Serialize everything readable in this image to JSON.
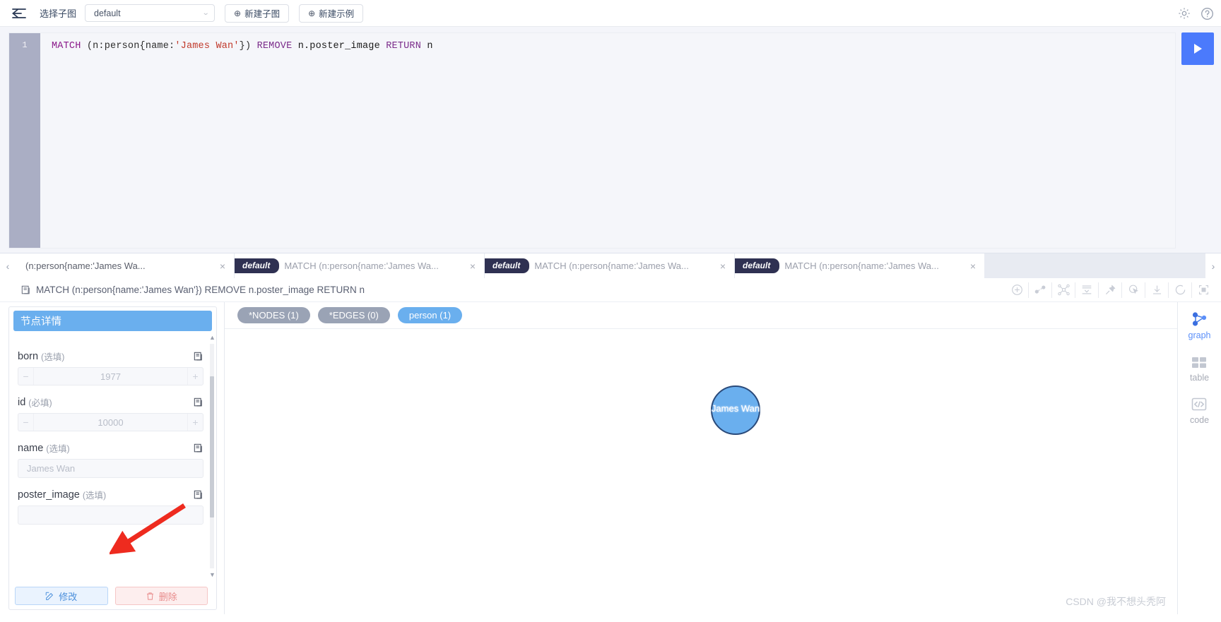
{
  "topbar": {
    "back_icon": "back-arrow-icon",
    "select_label": "选择子图",
    "selected_subgraph": "default",
    "new_subgraph_label": "新建子图",
    "new_sample_label": "新建示例",
    "settings_icon": "gear-icon",
    "help_icon": "question-circle-icon"
  },
  "editor": {
    "line_number": "1",
    "tokens": {
      "match": "MATCH",
      "pattern_open": " (n:person{name:",
      "string": "'James Wan'",
      "pattern_close": "}) ",
      "remove": "REMOVE",
      "prop": " n.poster_image ",
      "return": "RETURN",
      "var": " n"
    },
    "full_query": "MATCH (n:person{name:'James Wan'}) REMOVE n.poster_image RETURN n",
    "run_icon": "play-icon"
  },
  "tabs": {
    "prev_icon": "chevron-left-icon",
    "next_icon": "chevron-right-icon",
    "items": [
      {
        "badge": "",
        "title": "(n:person{name:'James Wa...",
        "close": "×"
      },
      {
        "badge": "default",
        "title": "MATCH (n:person{name:'James Wa...",
        "close": "×"
      },
      {
        "badge": "default",
        "title": "MATCH (n:person{name:'James Wa...",
        "close": "×"
      },
      {
        "badge": "default",
        "title": "MATCH (n:person{name:'James Wa...",
        "close": "×"
      }
    ]
  },
  "result_header": {
    "copy_icon": "copy-icon",
    "query": "MATCH (n:person{name:'James Wan'}) REMOVE n.poster_image RETURN n",
    "tools": [
      "add-circle-icon",
      "expand-nodes-icon",
      "network-icon",
      "collapse-icon",
      "pin-icon",
      "select-cursor-icon",
      "download-icon",
      "refresh-circle-icon",
      "fullscreen-icon"
    ]
  },
  "detail_panel": {
    "title": "节点详情",
    "fields": [
      {
        "name": "born",
        "required_label": "(选填)",
        "type": "number",
        "value": "1977",
        "copy_icon": "copy-icon"
      },
      {
        "name": "id",
        "required_label": "(必填)",
        "type": "number",
        "value": "10000",
        "copy_icon": "copy-icon"
      },
      {
        "name": "name",
        "required_label": "(选填)",
        "type": "text",
        "value": "James Wan",
        "copy_icon": "copy-icon"
      },
      {
        "name": "poster_image",
        "required_label": "(选填)",
        "type": "text",
        "value": "",
        "copy_icon": "copy-icon"
      }
    ],
    "edit_button": {
      "label": "修改",
      "icon": "edit-icon"
    },
    "delete_button": {
      "label": "删除",
      "icon": "trash-icon"
    }
  },
  "graph": {
    "chips": [
      {
        "label": "*NODES (1)",
        "color": "#9aa3b5"
      },
      {
        "label": "*EDGES (0)",
        "color": "#9aa3b5"
      },
      {
        "label": "person (1)",
        "color": "#6aafee"
      }
    ],
    "node": {
      "label": "James Wan",
      "fill": "#6aafee",
      "stroke": "#2a4a7a"
    },
    "watermark": "CSDN @我不想头秃阿"
  },
  "right_rail": {
    "items": [
      {
        "label": "graph",
        "icon": "graph-icon",
        "active": true
      },
      {
        "label": "table",
        "icon": "table-icon",
        "active": false
      },
      {
        "label": "code",
        "icon": "code-icon",
        "active": false
      }
    ]
  },
  "colors": {
    "accent_blue": "#6aafee",
    "run_blue": "#4b7afc",
    "badge_navy": "#2f3152",
    "gutter": "#aaaec4"
  }
}
